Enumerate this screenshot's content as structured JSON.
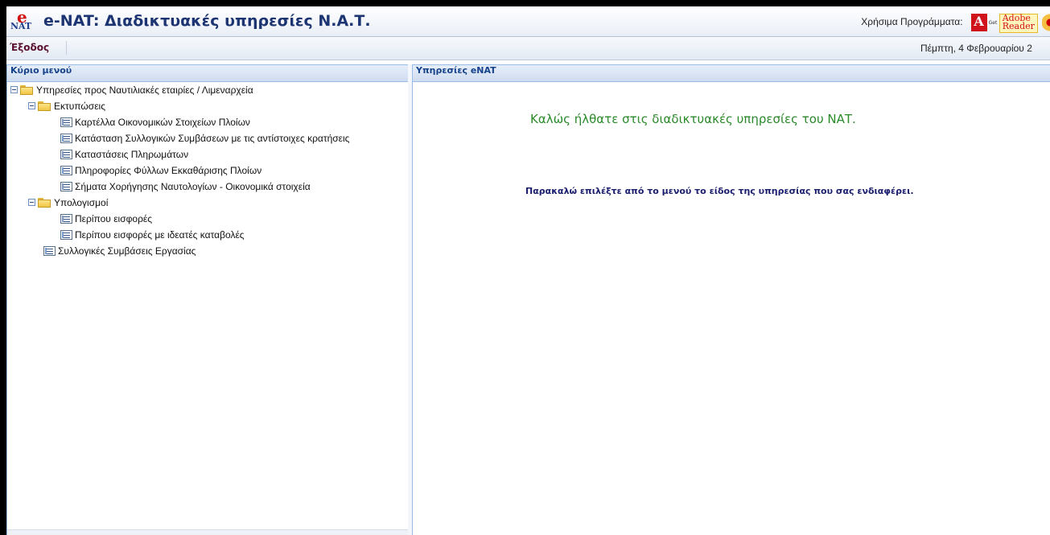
{
  "header": {
    "logo_e": "e",
    "logo_nat": "NAT",
    "title": "e-NAT: Διαδικτυακές υπηρεσίες Ν.Α.Τ.",
    "tools_label": "Χρήσιμα Προγράμματα:",
    "adobe_glyph": "A",
    "adobe_get": "Get",
    "reader_line1": "Adobe",
    "reader_line2": "Reader"
  },
  "menubar": {
    "exit_label": "Έξοδος",
    "date": "Πέμπτη, 4 Φεβρουαρίου 2"
  },
  "left_panel": {
    "title": "Κύριο μενού",
    "tree": {
      "root": "Υπηρεσίες προς Ναυτιλιακές εταιρίες / Λιμεναρχεία",
      "printouts": {
        "label": "Εκτυπώσεις",
        "items": [
          "Καρτέλλα Οικονομικών Στοιχείων Πλοίων",
          "Κατάσταση Συλλογικών Συμβάσεων με τις αντίστοιχες κρατήσεις",
          "Καταστάσεις Πληρωμάτων",
          "Πληροφορίες Φύλλων Εκκαθάρισης Πλοίων",
          "Σήματα Χορήγησης Ναυτολογίων - Οικονομικά στοιχεία"
        ]
      },
      "calculations": {
        "label": "Υπολογισμοί",
        "items": [
          "Περίπου εισφορές",
          "Περίπου εισφορές με ιδεατές καταβολές"
        ]
      },
      "agreements": "Συλλογικές Συμβάσεις Εργασίας"
    }
  },
  "right_panel": {
    "title": "Υπηρεσίες eNAT",
    "welcome": "Καλώς ήλθατε στις διαδικτυακές υπηρεσίες του ΝΑΤ.",
    "instruction": "Παρακαλώ επιλέξτε από το μενού το είδος της υπηρεσίας που σας ενδιαφέρει."
  }
}
